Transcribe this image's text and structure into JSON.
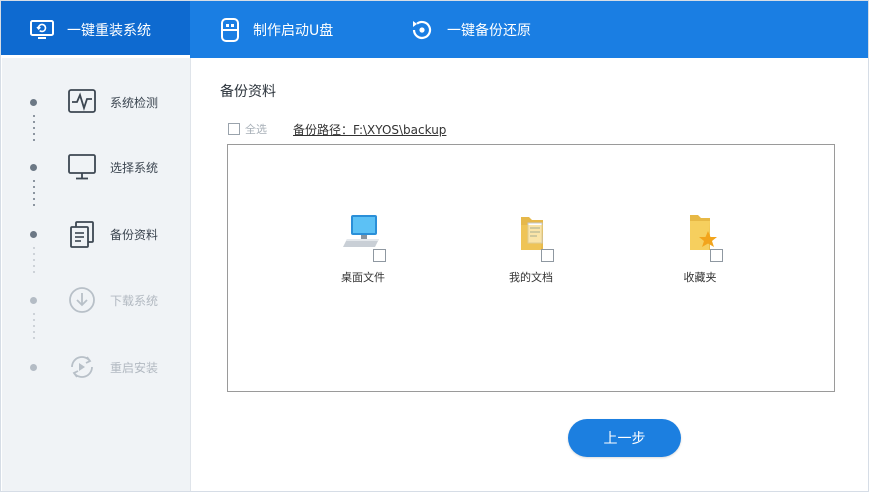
{
  "topbar": {
    "tabs": [
      {
        "label": "一键重装系统",
        "icon": "monitor-refresh-icon",
        "active": true
      },
      {
        "label": "制作启动U盘",
        "icon": "usb-drive-icon",
        "active": false
      },
      {
        "label": "一键备份还原",
        "icon": "restore-icon",
        "active": false
      }
    ]
  },
  "sidebar": {
    "steps": [
      {
        "label": "系统检测",
        "icon": "pulse-monitor-icon",
        "state": "done"
      },
      {
        "label": "选择系统",
        "icon": "monitor-icon",
        "state": "done"
      },
      {
        "label": "备份资料",
        "icon": "documents-icon",
        "state": "current"
      },
      {
        "label": "下载系统",
        "icon": "download-icon",
        "state": "inactive"
      },
      {
        "label": "重启安装",
        "icon": "reboot-icon",
        "state": "inactive"
      }
    ]
  },
  "main": {
    "title": "备份资料",
    "select_all_label": "全选",
    "backup_path": "备份路径：F:\\XYOS\\backup",
    "files": [
      {
        "label": "桌面文件",
        "icon": "desktop-computer-icon",
        "checked": false
      },
      {
        "label": "我的文档",
        "icon": "document-folder-icon",
        "checked": false
      },
      {
        "label": "收藏夹",
        "icon": "favorites-folder-icon",
        "checked": false
      }
    ],
    "prev_button": "上一步"
  },
  "colors": {
    "brand": "#1a7ee3",
    "sidebar_bg": "#f0f3f6",
    "button": "#1c7fe0"
  }
}
